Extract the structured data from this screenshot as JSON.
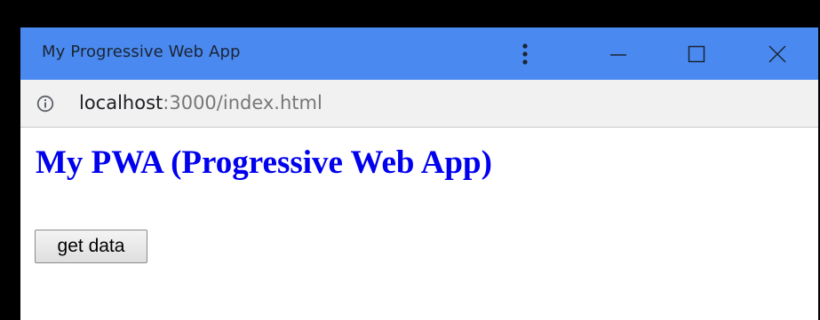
{
  "window": {
    "title": "My Progressive Web App",
    "controls": [
      "more-icon",
      "minimize-icon",
      "maximize-icon",
      "close-icon"
    ]
  },
  "address": {
    "host": "localhost",
    "path": ":3000/index.html",
    "icon": "info-icon"
  },
  "page": {
    "heading": "My PWA (Progressive Web App)",
    "button_label": "get data"
  },
  "colors": {
    "titlebar": "#4a8af0",
    "heading": "#0000ee",
    "address_bg": "#f1f1f2"
  }
}
